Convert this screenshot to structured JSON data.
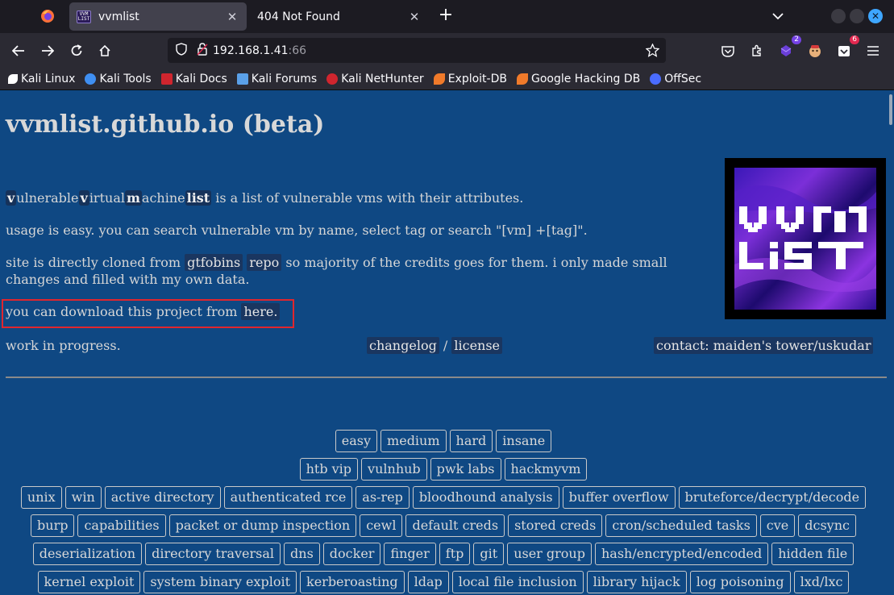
{
  "browser": {
    "tabs": [
      {
        "title": "vvmlist",
        "active": true
      },
      {
        "title": "404 Not Found",
        "active": false
      }
    ],
    "new_tab": "+",
    "url": {
      "host": "192.168.1.41",
      "port": ":66"
    },
    "extension_badges": {
      "ext1": "2",
      "ext3": "6"
    },
    "bookmarks": [
      {
        "label": "Kali Linux",
        "color": "#ffffff"
      },
      {
        "label": "Kali Tools",
        "color": "#3f8ff2"
      },
      {
        "label": "Kali Docs",
        "color": "#d0252e"
      },
      {
        "label": "Kali Forums",
        "color": "#5aa0e8"
      },
      {
        "label": "Kali NetHunter",
        "color": "#d0252e"
      },
      {
        "label": "Exploit-DB",
        "color": "#f07a2a"
      },
      {
        "label": "Google Hacking DB",
        "color": "#f07a2a"
      },
      {
        "label": "OffSec",
        "color": "#4a6cff"
      }
    ]
  },
  "page": {
    "title": "vvmlist.github.io (beta)",
    "intro": {
      "v1": "v",
      "t1": "ulnerable",
      "v2": "v",
      "t2": "irtual",
      "m": "m",
      "t3": "achine",
      "list": "list",
      "t4": " is a list of vulnerable vms with their attributes."
    },
    "usage": "usage is easy. you can search vulnerable vm by name, select tag or search \"[vm] +[tag]\".",
    "cloned": {
      "pre": "site is directly cloned from ",
      "link1": "gtfobins",
      "link2": "repo",
      "post": " so majority of the credits goes for them. i only made small changes and filled with my own data."
    },
    "download": {
      "pre": "you can download this project from ",
      "link": "here."
    },
    "footer": {
      "wip": "work in progress.",
      "changelog": "changelog",
      "slash": " / ",
      "license": "license",
      "contact": "contact: maiden's tower/uskudar"
    },
    "logo_text": [
      "VVM",
      "LIST"
    ],
    "tag_rows": [
      [
        "easy",
        "medium",
        "hard",
        "insane"
      ],
      [
        "htb vip",
        "vulnhub",
        "pwk labs",
        "hackmyvm"
      ],
      [
        "unix",
        "win",
        "active directory",
        "authenticated rce",
        "as-rep",
        "bloodhound analysis",
        "buffer overflow",
        "bruteforce/decrypt/decode"
      ],
      [
        "burp",
        "capabilities",
        "packet or dump inspection",
        "cewl",
        "default creds",
        "stored creds",
        "cron/scheduled tasks",
        "cve",
        "dcsync"
      ],
      [
        "deserialization",
        "directory traversal",
        "dns",
        "docker",
        "finger",
        "ftp",
        "git",
        "user group",
        "hash/encrypted/encoded",
        "hidden file"
      ],
      [
        "kernel exploit",
        "system binary exploit",
        "kerberoasting",
        "ldap",
        "local file inclusion",
        "library hijack",
        "log poisoning",
        "lxd/lxc"
      ]
    ]
  }
}
